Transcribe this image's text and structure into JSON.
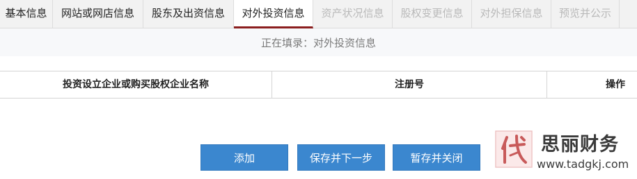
{
  "tabs": [
    {
      "label": "基本信息",
      "state": "normal"
    },
    {
      "label": "网站或网店信息",
      "state": "normal"
    },
    {
      "label": "股东及出资信息",
      "state": "normal"
    },
    {
      "label": "对外投资信息",
      "state": "active"
    },
    {
      "label": "资产状况信息",
      "state": "disabled"
    },
    {
      "label": "股权变更信息",
      "state": "disabled"
    },
    {
      "label": "对外担保信息",
      "state": "disabled"
    },
    {
      "label": "预览并公示",
      "state": "disabled"
    }
  ],
  "status": {
    "text": "正在填录：对外投资信息"
  },
  "table": {
    "columns": [
      "投资设立企业或购买股权企业名称",
      "注册号",
      "操作"
    ],
    "rows": []
  },
  "buttons": {
    "add": "添加",
    "save_next": "保存并下一步",
    "save_close": "暂存并关闭"
  },
  "watermark": {
    "seal_char": "代",
    "name": "思丽财务",
    "url": "www.tadgkj.com"
  },
  "colors": {
    "accent_button": "#3b87cf",
    "active_tab_underline": "#8b1e1e",
    "disabled_tab_text": "#b9b9b9"
  }
}
